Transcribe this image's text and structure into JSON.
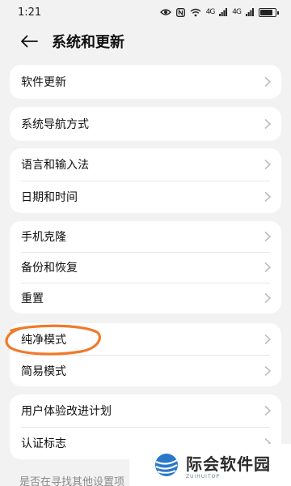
{
  "status_bar": {
    "time": "1:21",
    "signal1": "4G",
    "signal2": "4G",
    "battery_level": 0.85
  },
  "header": {
    "title": "系统和更新"
  },
  "groups": [
    {
      "items": [
        {
          "label": "软件更新"
        }
      ]
    },
    {
      "items": [
        {
          "label": "系统导航方式"
        }
      ]
    },
    {
      "items": [
        {
          "label": "语言和输入法"
        },
        {
          "label": "日期和时间"
        }
      ]
    },
    {
      "items": [
        {
          "label": "手机克隆"
        },
        {
          "label": "备份和恢复"
        },
        {
          "label": "重置"
        }
      ]
    },
    {
      "items": [
        {
          "label": "纯净模式"
        },
        {
          "label": "简易模式"
        }
      ]
    },
    {
      "items": [
        {
          "label": "用户体验改进计划"
        },
        {
          "label": "认证标志"
        }
      ]
    }
  ],
  "footer_hint": "是否在寻找其他设置项",
  "watermark": {
    "title": "际会软件园",
    "subtitle": "ZUIHUITOP"
  },
  "colors": {
    "background": "#f2f2f2",
    "card": "#ffffff",
    "annotation": "#f07a2a"
  }
}
